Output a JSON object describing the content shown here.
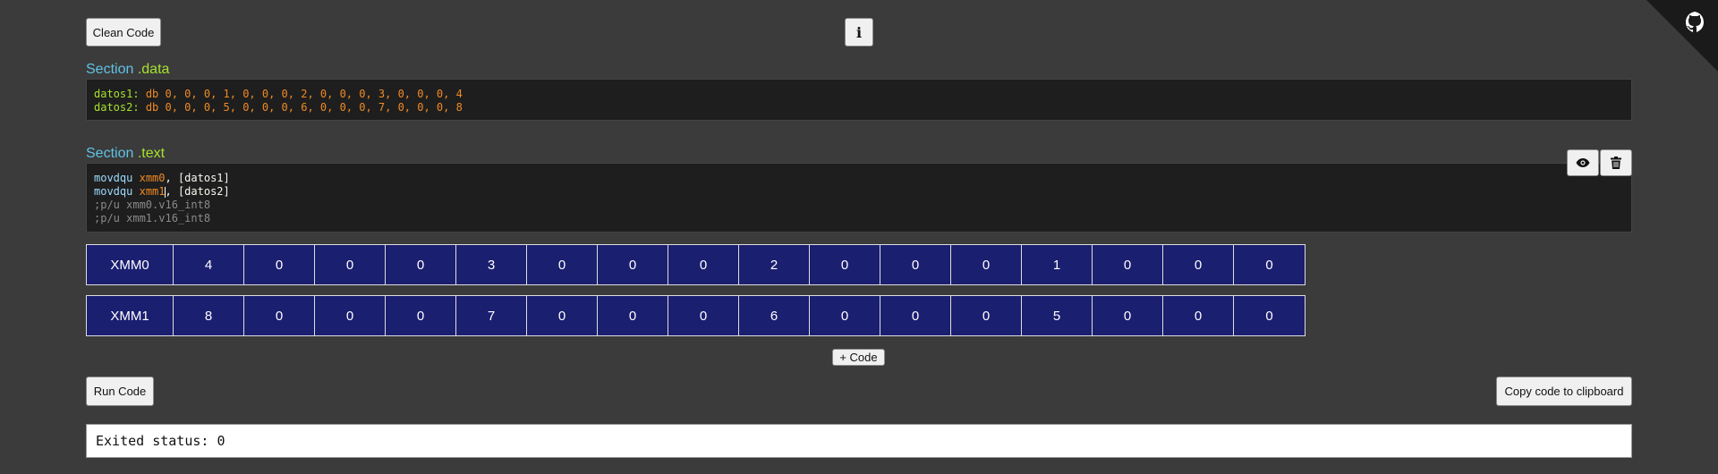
{
  "toolbar": {
    "clean_label": "Clean Code",
    "info_label": "i",
    "add_code_label": "+ Code",
    "run_label": "Run Code",
    "copy_label": "Copy code to clipboard"
  },
  "data_section": {
    "keyword": "Section",
    "name": ".data",
    "lines": [
      {
        "label": "datos1:",
        "directive": "db",
        "values": "0, 0, 0, 1, 0, 0, 0, 2, 0, 0, 0, 3, 0, 0, 0, 4"
      },
      {
        "label": "datos2:",
        "directive": "db",
        "values": "0, 0, 0, 5, 0, 0, 0, 6, 0, 0, 0, 7, 0, 0, 0, 8"
      }
    ]
  },
  "text_section": {
    "keyword": "Section",
    "name": ".text",
    "lines": [
      {
        "instr": "movdqu",
        "reg": "xmm0",
        "rest": ", [datos1]"
      },
      {
        "instr": "movdqu",
        "reg": "xmm1",
        "rest": ", [datos2]"
      },
      {
        "comment": ";p/u xmm0.v16_int8"
      },
      {
        "comment": ";p/u xmm1.v16_int8"
      }
    ]
  },
  "registers": [
    {
      "name": "XMM0",
      "values": [
        "4",
        "0",
        "0",
        "0",
        "3",
        "0",
        "0",
        "0",
        "2",
        "0",
        "0",
        "0",
        "1",
        "0",
        "0",
        "0"
      ]
    },
    {
      "name": "XMM1",
      "values": [
        "8",
        "0",
        "0",
        "0",
        "7",
        "0",
        "0",
        "0",
        "6",
        "0",
        "0",
        "0",
        "5",
        "0",
        "0",
        "0"
      ]
    }
  ],
  "output": {
    "text": "Exited status: 0"
  },
  "icons": {
    "info": "info-icon",
    "view": "eye-icon",
    "delete": "trash-icon",
    "corner": "github-octocat-icon"
  },
  "colors": {
    "background": "#3b3b3b",
    "register_cell": "#1b1f70",
    "section_keyword": "#5fc3e4",
    "section_name": "#a6e22e"
  }
}
